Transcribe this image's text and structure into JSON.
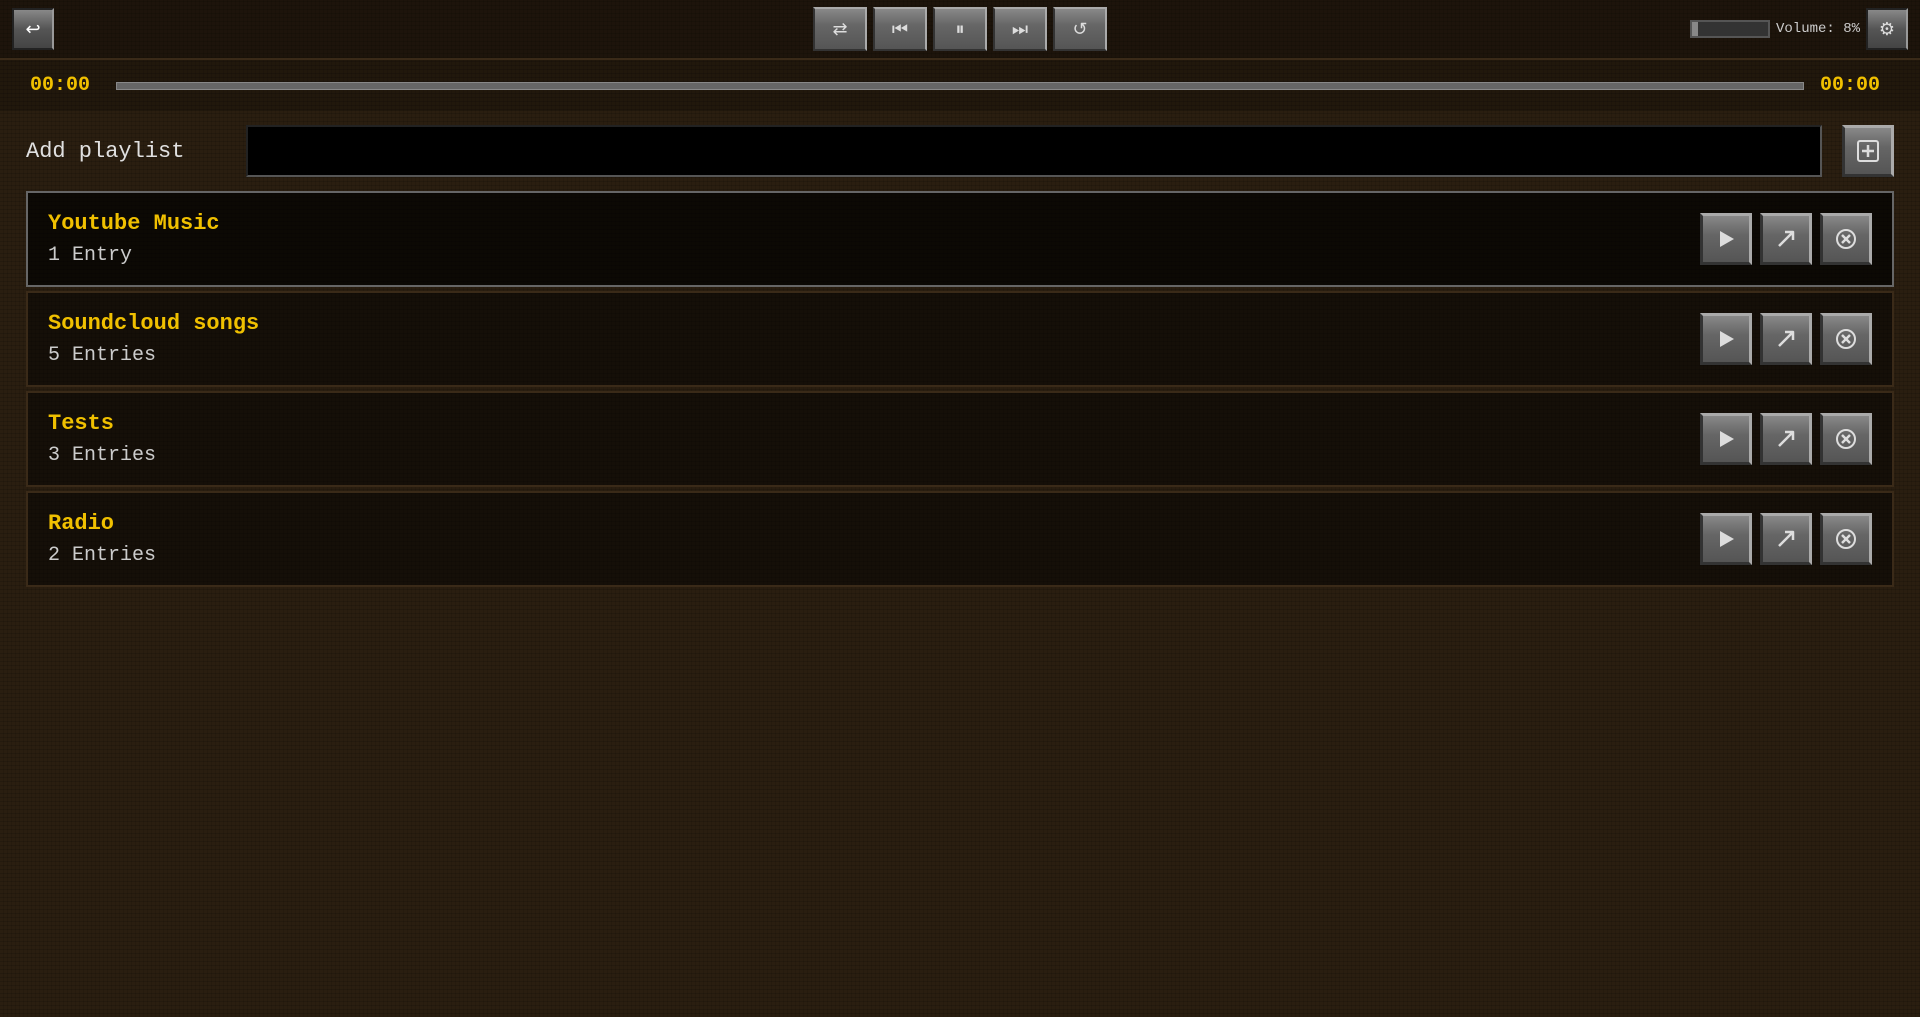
{
  "topbar": {
    "back_icon": "↩",
    "volume_label": "Volume: 8%",
    "settings_icon": "⚙"
  },
  "transport": {
    "shuffle_icon": "⇄",
    "prev_icon": "⏮",
    "pause_icon": "⏸",
    "next_icon": "⏭",
    "repeat_icon": "↺"
  },
  "seekbar": {
    "time_current": "00:00",
    "time_total": "00:00"
  },
  "add_playlist": {
    "label": "Add playlist",
    "input_placeholder": "",
    "add_icon": "⊞"
  },
  "playlists": [
    {
      "name": "Youtube Music",
      "entries": "1 Entry"
    },
    {
      "name": "Soundcloud songs",
      "entries": "5 Entries"
    },
    {
      "name": "Tests",
      "entries": "3 Entries"
    },
    {
      "name": "Radio",
      "entries": "2 Entries"
    }
  ],
  "action_icons": {
    "play": "▶",
    "export": "↗",
    "close": "✕"
  }
}
